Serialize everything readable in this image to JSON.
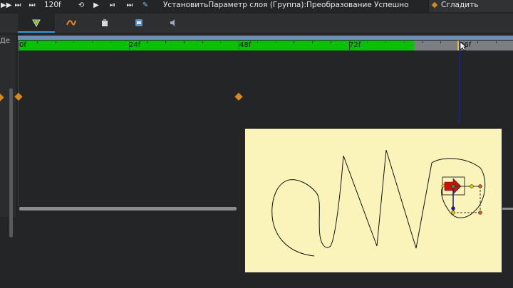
{
  "toolbar": {
    "icons": [
      "skip-next-icon",
      "skip-end-icon",
      "loop-icon",
      "play-icon",
      "next-keyframe-icon",
      "end-icon",
      "pen-icon"
    ],
    "frame_count": "120f",
    "status_message": "УстановитьПараметр слоя (Группа):Преобразование Успешно",
    "smooth_button_label": "Сгладить"
  },
  "tabs": [
    {
      "name": "params-tab-icon",
      "active": true
    },
    {
      "name": "curves-tab-icon",
      "active": false
    },
    {
      "name": "library-tab-icon",
      "active": false
    },
    {
      "name": "sets-tab-icon",
      "active": false
    },
    {
      "name": "sound-tab-icon",
      "active": false
    }
  ],
  "left_panel": {
    "label": "Де"
  },
  "timeline": {
    "ruler_labels": [
      "0f",
      "24f",
      "48f",
      "72f",
      "96f"
    ],
    "green_range_fraction": 0.8,
    "current_frame": 96,
    "colors": {
      "range": "#00c400",
      "keyframe": "#d8881e",
      "playhead": "#e8c000"
    }
  },
  "canvas": {
    "background": "#faf4bb"
  }
}
